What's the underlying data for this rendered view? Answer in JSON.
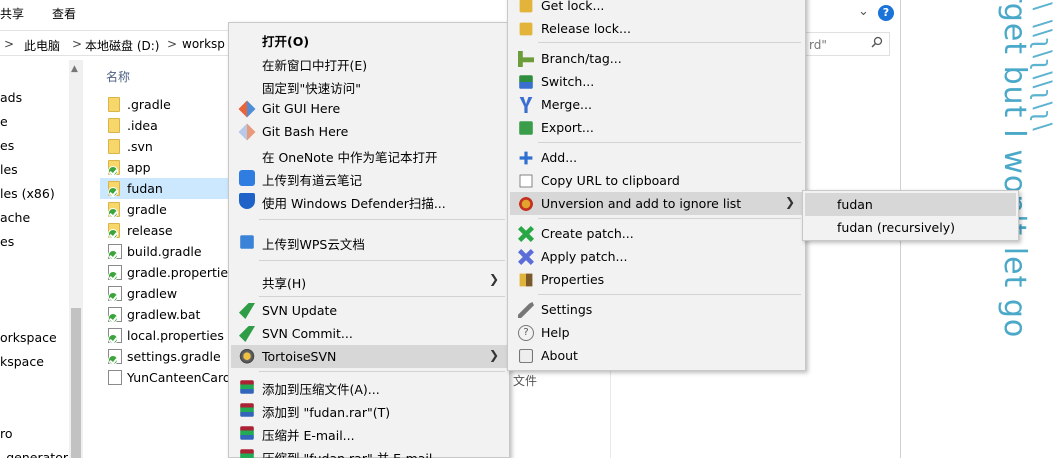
{
  "ribbon": {
    "tab_share": "共享",
    "tab_view": "查看",
    "help_icon": "?"
  },
  "address": {
    "segments": [
      "此电脑",
      "本地磁盘 (D:)",
      "worksp"
    ],
    "separator": ">",
    "search_placeholder": "rd\""
  },
  "nav": {
    "items": [
      "ads",
      "e",
      "es",
      "les",
      "les (x86)",
      "ache",
      "es",
      "orkspace",
      "kspace",
      "ro",
      "_generator"
    ]
  },
  "files": {
    "column_name": "名称",
    "type_column": "文件",
    "rows": [
      {
        "name": ".gradle",
        "kind": "folder",
        "badge": false
      },
      {
        "name": ".idea",
        "kind": "folder",
        "badge": false
      },
      {
        "name": ".svn",
        "kind": "folder",
        "badge": false
      },
      {
        "name": "app",
        "kind": "folder",
        "badge": true
      },
      {
        "name": "fudan",
        "kind": "folder",
        "badge": true
      },
      {
        "name": "gradle",
        "kind": "folder",
        "badge": true
      },
      {
        "name": "release",
        "kind": "folder",
        "badge": true
      },
      {
        "name": "build.gradle",
        "kind": "file",
        "badge": true
      },
      {
        "name": "gradle.properties",
        "kind": "file",
        "badge": true
      },
      {
        "name": "gradlew",
        "kind": "file",
        "badge": true
      },
      {
        "name": "gradlew.bat",
        "kind": "file",
        "badge": true
      },
      {
        "name": "local.properties",
        "kind": "file",
        "badge": true
      },
      {
        "name": "settings.gradle",
        "kind": "file",
        "badge": true
      },
      {
        "name": "YunCanteenCard.",
        "kind": "file",
        "badge": false
      }
    ]
  },
  "context_menu": {
    "open": "打开(O)",
    "open_new_window": "在新窗口中打开(E)",
    "pin_quick_access": "固定到\"快速访问\"",
    "git_gui": "Git GUI Here",
    "git_bash": "Git Bash Here",
    "onenote": "在 OneNote 中作为笔记本打开",
    "youdao": "上传到有道云笔记",
    "defender": "使用 Windows Defender扫描...",
    "wps": "上传到WPS云文档",
    "share": "共享(H)",
    "svn_update": "SVN Update",
    "svn_commit": "SVN Commit...",
    "tortoise": "TortoiseSVN",
    "add_archive": "添加到压缩文件(A)...",
    "add_rar": "添加到 \"fudan.rar\"(T)",
    "compress_email": "压缩并 E-mail...",
    "compress_rar_email": "压缩到 \"fudan.rar\" 并 E-mail"
  },
  "svn_menu": {
    "get_lock": "Get lock...",
    "release_lock": "Release lock...",
    "branch": "Branch/tag...",
    "switch": "Switch...",
    "merge": "Merge...",
    "export": "Export...",
    "add": "Add...",
    "copy_url": "Copy URL to clipboard",
    "unversion": "Unversion and add to ignore list",
    "create_patch": "Create patch...",
    "apply_patch": "Apply patch...",
    "properties": "Properties",
    "settings": "Settings",
    "help": "Help",
    "about": "About"
  },
  "ignore_menu": {
    "item1": "fudan",
    "item2": "fudan (recursively)"
  },
  "side_text": {
    "line1": "rget but I won't let go",
    "line2": "ʅ\\ \\\\ʅ\\ʅ\\\\ʅ\\ʅ\\"
  }
}
